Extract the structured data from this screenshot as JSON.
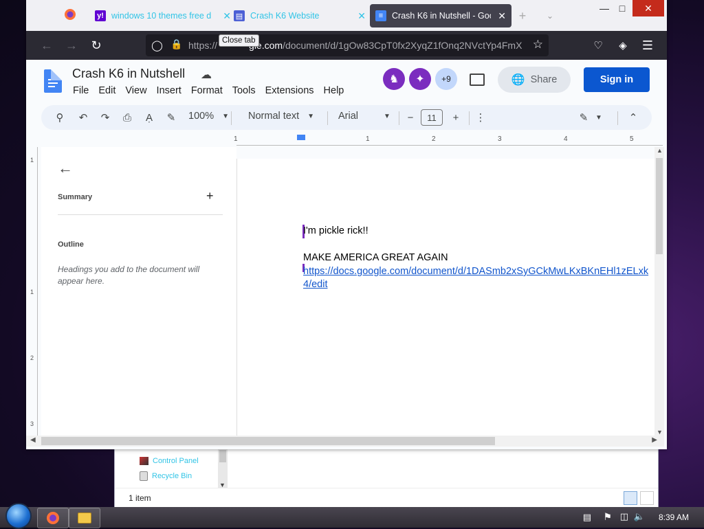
{
  "explorer": {
    "items": [
      {
        "label": "Control Panel"
      },
      {
        "label": "Recycle Bin"
      }
    ],
    "status": "1 item"
  },
  "browser": {
    "tabs": [
      {
        "label": "windows 10 themes free d",
        "favicon": "yahoo"
      },
      {
        "label": "Crash K6 Website",
        "favicon": "sites"
      },
      {
        "label": "Crash K6 in Nutshell - Goog",
        "favicon": "docs",
        "active": true
      }
    ],
    "tooltip": "Close tab",
    "url_prefix": "https://",
    "url_host": "gle.com",
    "url_path": "/document/d/1gOw83CpT0fx2XyqZ1fOnq2NVctYp4FmX"
  },
  "docs": {
    "title": "Crash K6 in Nutshell",
    "menu": [
      "File",
      "Edit",
      "View",
      "Insert",
      "Format",
      "Tools",
      "Extensions",
      "Help"
    ],
    "avatars_extra": "+9",
    "share_label": "Share",
    "signin_label": "Sign in",
    "toolbar": {
      "zoom": "100%",
      "style": "Normal text",
      "font": "Arial",
      "font_size": "11"
    },
    "ruler_ticks": [
      "1",
      "1",
      "2",
      "3",
      "4",
      "5"
    ],
    "left_ruler_ticks": [
      "1",
      "1",
      "2",
      "3"
    ],
    "sidebar": {
      "summary_label": "Summary",
      "outline_label": "Outline",
      "outline_hint": "Headings you add to the document will appear here."
    },
    "content": {
      "line1": "I'm pickle rick!!",
      "line2": "MAKE AMERICA GREAT AGAIN",
      "link_line1": "https://docs.google.com/document/d/1DASmb2xSyGCkMwLKxBKnEHl1zELxk",
      "link_line2": "4/edit"
    }
  },
  "taskbar": {
    "time": "8:39 AM"
  },
  "colors": {
    "accent_blue": "#0b57d0",
    "tab_text_cyan": "#31c4e6",
    "avatar_purple": "#7b2dbf"
  }
}
